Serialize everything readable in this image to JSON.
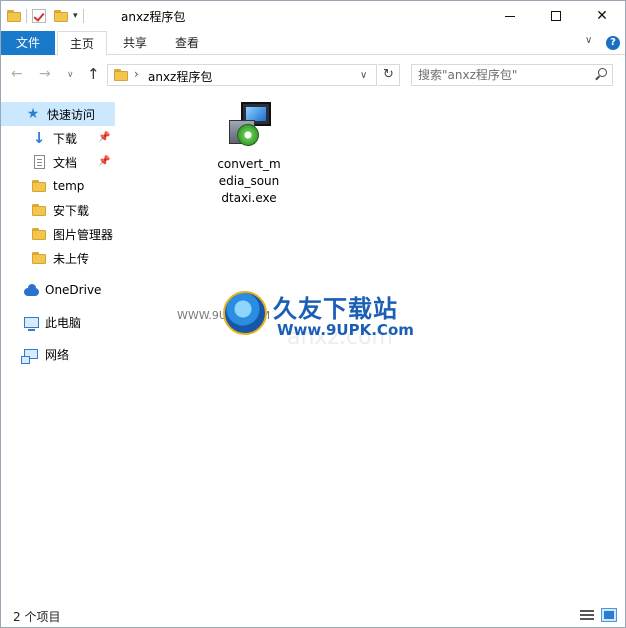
{
  "titlebar": {
    "title": "anxz程序包",
    "qat_dropdown_glyph": "▾",
    "minimize_label": "Minimize",
    "maximize_label": "Maximize",
    "close_glyph": "✕"
  },
  "ribbon": {
    "tabs": [
      {
        "label": "文件"
      },
      {
        "label": "主页"
      },
      {
        "label": "共享"
      },
      {
        "label": "查看"
      }
    ],
    "expand_glyph": "∨",
    "help_glyph": "?"
  },
  "navbar": {
    "back_glyph": "←",
    "forward_glyph": "→",
    "recent_glyph": "∨",
    "up_glyph": "↑",
    "address_separator": "›",
    "address": "anxz程序包",
    "address_dropdown_glyph": "∨",
    "refresh_glyph": "↻",
    "search_placeholder": "搜索\"anxz程序包\""
  },
  "sidebar": {
    "items": [
      {
        "label": "快速访问",
        "icon": "star-icon"
      },
      {
        "label": "下载",
        "icon": "download-icon",
        "pin": "📌"
      },
      {
        "label": "文档",
        "icon": "document-icon",
        "pin": "📌"
      },
      {
        "label": "temp",
        "icon": "folder-icon"
      },
      {
        "label": "安下载",
        "icon": "folder-icon"
      },
      {
        "label": "图片管理器",
        "icon": "folder-icon"
      },
      {
        "label": "未上传",
        "icon": "folder-icon"
      },
      {
        "label": "OneDrive",
        "icon": "cloud-icon"
      },
      {
        "label": "此电脑",
        "icon": "computer-icon"
      },
      {
        "label": "网络",
        "icon": "network-icon"
      }
    ]
  },
  "content": {
    "files": [
      {
        "name": "convert_media_soundtaxi.exe",
        "icon": "installer-icon"
      }
    ]
  },
  "watermark": {
    "brand": "久友下载站",
    "url": "Www.9UPK.Com",
    "left_text": "WWW.9UPK.COM",
    "ghost_text": "anxz.com"
  },
  "statusbar": {
    "item_count": "2 个项目"
  },
  "colors": {
    "file_tab": "#1979ca",
    "selected_nav": "#cce8ff",
    "accent": "#1a6fc2"
  }
}
